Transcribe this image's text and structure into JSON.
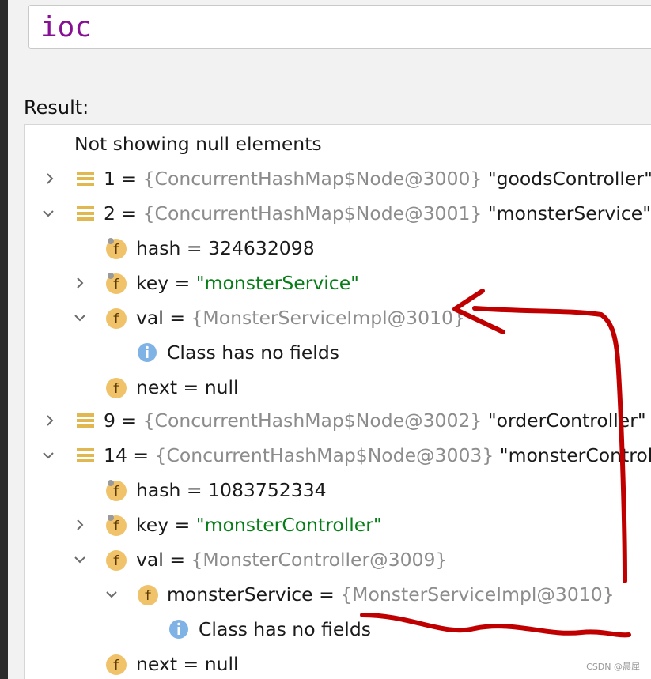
{
  "expression": {
    "value": "ioc"
  },
  "result": {
    "label": "Result:",
    "note": "Not showing null elements",
    "rows": [
      {
        "name": "1",
        "type": "{ConcurrentHashMap$Node@3000}",
        "str": "\"goodsController\""
      },
      {
        "name": "2",
        "type": "{ConcurrentHashMap$Node@3001}",
        "str": "\"monsterService\""
      },
      {
        "hash": "hash",
        "hash_eq": " = ",
        "hash_val": "324632098"
      },
      {
        "key": "key",
        "key_eq": " = ",
        "key_val": "\"monsterService\""
      },
      {
        "val": "val",
        "val_eq": " = ",
        "val_type": "{MonsterServiceImpl@3010}"
      },
      {
        "info": "Class has no fields"
      },
      {
        "next": "next",
        "next_eq": " = ",
        "next_val": "null"
      },
      {
        "name": "9",
        "type": "{ConcurrentHashMap$Node@3002}",
        "str": "\"orderController\""
      },
      {
        "name": "14",
        "type": "{ConcurrentHashMap$Node@3003}",
        "str": "\"monsterController\""
      },
      {
        "hash": "hash",
        "hash_eq": " = ",
        "hash_val": "1083752334"
      },
      {
        "key": "key",
        "key_eq": " = ",
        "key_val": "\"monsterController\""
      },
      {
        "val": "val",
        "val_eq": " = ",
        "val_type": "{MonsterController@3009}"
      },
      {
        "field": "monsterService",
        "field_eq": " = ",
        "field_type": "{MonsterServiceImpl@3010}"
      },
      {
        "info": "Class has no fields"
      },
      {
        "next": "next",
        "next_eq": " = ",
        "next_val": "null"
      }
    ]
  },
  "equals": " = ",
  "watermark": "CSDN @晨犀",
  "icons": {
    "collapsed": "chevron-right-icon",
    "expanded": "chevron-down-icon",
    "entry": "map-entry-icon",
    "field": "field-icon",
    "info": "info-icon"
  },
  "colors": {
    "expression": "#871094",
    "reference": "#8c8c8c",
    "string": "#067d17",
    "field_icon": "#f0c36a",
    "entry_icon": "#e0b84f",
    "info_icon": "#7fb2e5",
    "annotation": "#c00000"
  }
}
